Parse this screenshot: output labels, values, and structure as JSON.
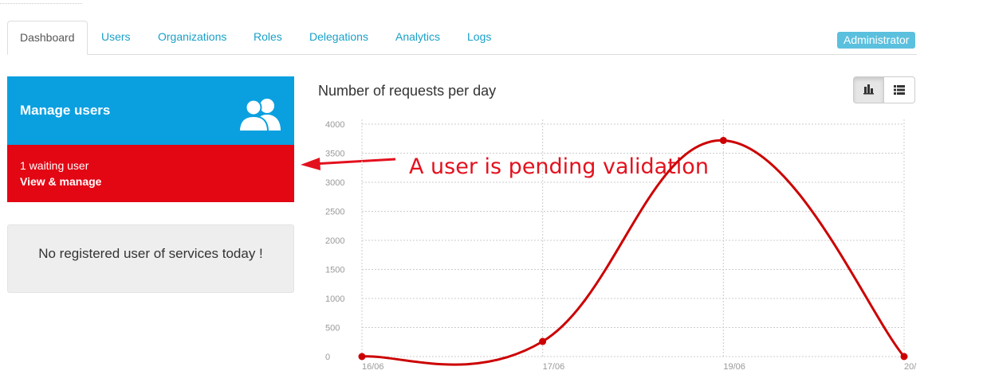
{
  "tabs": [
    {
      "label": "Dashboard",
      "active": true
    },
    {
      "label": "Users"
    },
    {
      "label": "Organizations"
    },
    {
      "label": "Roles"
    },
    {
      "label": "Delegations"
    },
    {
      "label": "Analytics"
    },
    {
      "label": "Logs"
    }
  ],
  "role_badge": "Administrator",
  "manage_panel": {
    "title": "Manage users",
    "icon": "users-icon",
    "waiting_text": "1 waiting user",
    "manage_link": "View & manage"
  },
  "services_panel": {
    "message": "No registered user of services today !"
  },
  "annotation": {
    "text": "A user is pending validation",
    "color": "#e3111e"
  },
  "colors": {
    "accent": "#1aa0c8",
    "manage_blue": "#0aa0e0",
    "alert_red": "#e30613",
    "series_red": "#cc0000",
    "badge": "#5bc0de"
  },
  "chart_toggle": {
    "options": [
      "bar-chart-icon",
      "list-icon"
    ],
    "active": "bar-chart-icon"
  },
  "chart_data": {
    "type": "line",
    "title": "Number of requests per day",
    "categories": [
      "16/06",
      "17/06",
      "19/06",
      "20/"
    ],
    "series": [
      {
        "values": [
          0,
          260,
          3720,
          0
        ]
      }
    ],
    "yticks": [
      0,
      500,
      1000,
      1500,
      2000,
      2500,
      3000,
      3500,
      4000
    ],
    "ylim": [
      0,
      4000
    ],
    "grid": true,
    "xlabel": "",
    "ylabel": ""
  }
}
